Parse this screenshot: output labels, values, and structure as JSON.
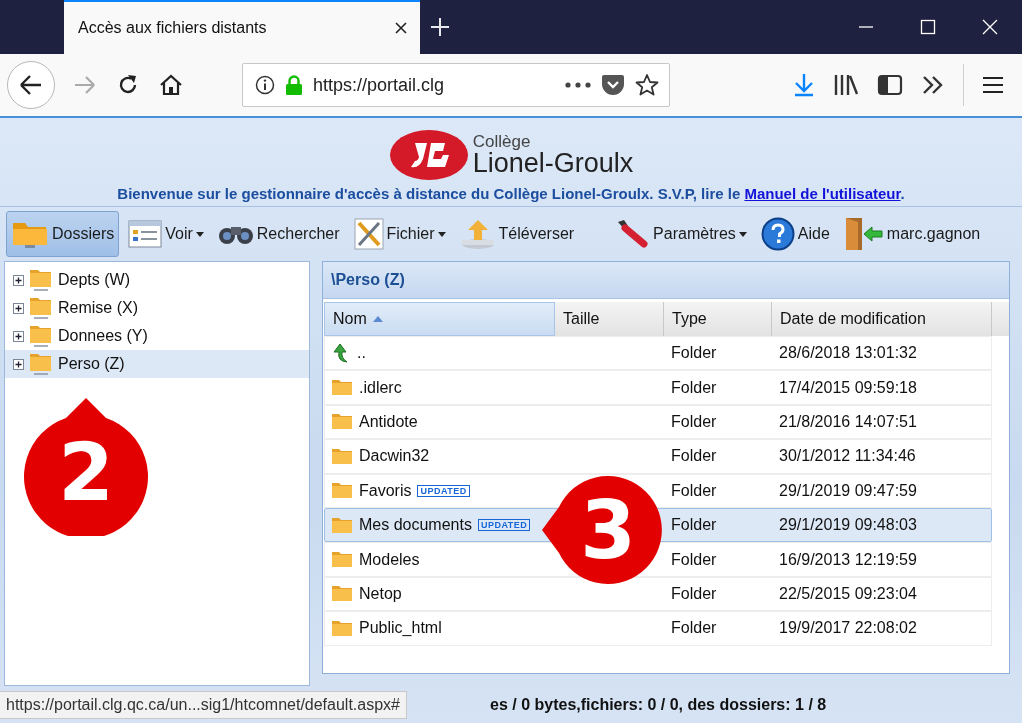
{
  "browser": {
    "tab": {
      "title": "Accès aux fichiers distants",
      "selected": true
    },
    "url": "https://portail.clg"
  },
  "header": {
    "logo_small": "Collège",
    "logo_large": "Lionel-Groulx",
    "welcome": "Bienvenue sur le gestionnaire d'accès à distance du Collège Lionel-Groulx. S.V.P, lire le ",
    "link": "Manuel de l'utilisateur",
    "welcome_end": "."
  },
  "toolbar": [
    {
      "label": "Dossiers",
      "selected": true,
      "menu": false
    },
    {
      "label": "Voir",
      "selected": false,
      "menu": true
    },
    {
      "label": "Rechercher",
      "selected": false,
      "menu": false
    },
    {
      "label": "Fichier",
      "selected": false,
      "menu": true
    },
    {
      "label": "Téléverser",
      "selected": false,
      "menu": false
    },
    {
      "label": "Paramètres",
      "selected": false,
      "menu": true
    },
    {
      "label": "Aide",
      "selected": false,
      "menu": false
    },
    {
      "label": "marc.gagnon",
      "selected": false,
      "menu": false
    }
  ],
  "tree": [
    {
      "label": "Depts (W)",
      "expanded": false,
      "selected": false
    },
    {
      "label": "Remise (X)",
      "expanded": false,
      "selected": false
    },
    {
      "label": "Donnees (Y)",
      "expanded": false,
      "selected": false
    },
    {
      "label": "Perso (Z)",
      "expanded": false,
      "selected": true
    }
  ],
  "folder_panel": {
    "path": "\\Perso (Z)",
    "columns": [
      {
        "label": "Nom",
        "sorted": true
      },
      {
        "label": "Taille",
        "sorted": false
      },
      {
        "label": "Type",
        "sorted": false
      },
      {
        "label": "Date de modification",
        "sorted": false
      }
    ],
    "rows": [
      {
        "kind": "parent",
        "name": "..",
        "type": "Folder",
        "modified": "28/6/2018 13:01:32",
        "selected": false
      },
      {
        "kind": "folder",
        "name": ".idlerc",
        "type": "Folder",
        "modified": "17/4/2015 09:59:18",
        "selected": false
      },
      {
        "kind": "folder",
        "name": "Antidote",
        "type": "Folder",
        "modified": "21/8/2016 14:07:51",
        "selected": false
      },
      {
        "kind": "folder",
        "name": "Dacwin32",
        "type": "Folder",
        "modified": "30/1/2012 11:34:46",
        "selected": false
      },
      {
        "kind": "folder",
        "name": "Favoris",
        "badge": "UPDATED",
        "type": "Folder",
        "modified": "29/1/2019 09:47:59",
        "selected": false
      },
      {
        "kind": "folder",
        "name": "Mes documents",
        "badge": "UPDATED",
        "type": "Folder",
        "modified": "29/1/2019 09:48:03",
        "selected": true
      },
      {
        "kind": "folder",
        "name": "Modeles",
        "type": "Folder",
        "modified": "16/9/2013 12:19:59",
        "selected": false
      },
      {
        "kind": "folder",
        "name": "Netop",
        "type": "Folder",
        "modified": "22/5/2015 09:23:04",
        "selected": false
      },
      {
        "kind": "folder",
        "name": "Public_html",
        "type": "Folder",
        "modified": "19/9/2017 22:08:02",
        "selected": false
      }
    ]
  },
  "status_bar": {
    "text": "es / 0 bytes,fichiers: 0 / 0, des dossiers: 1 / 8"
  },
  "link_preview": "https://portail.clg.qc.ca/un...sig1/htcomnet/default.aspx#",
  "callouts": [
    {
      "label": "2"
    },
    {
      "label": "3"
    }
  ]
}
